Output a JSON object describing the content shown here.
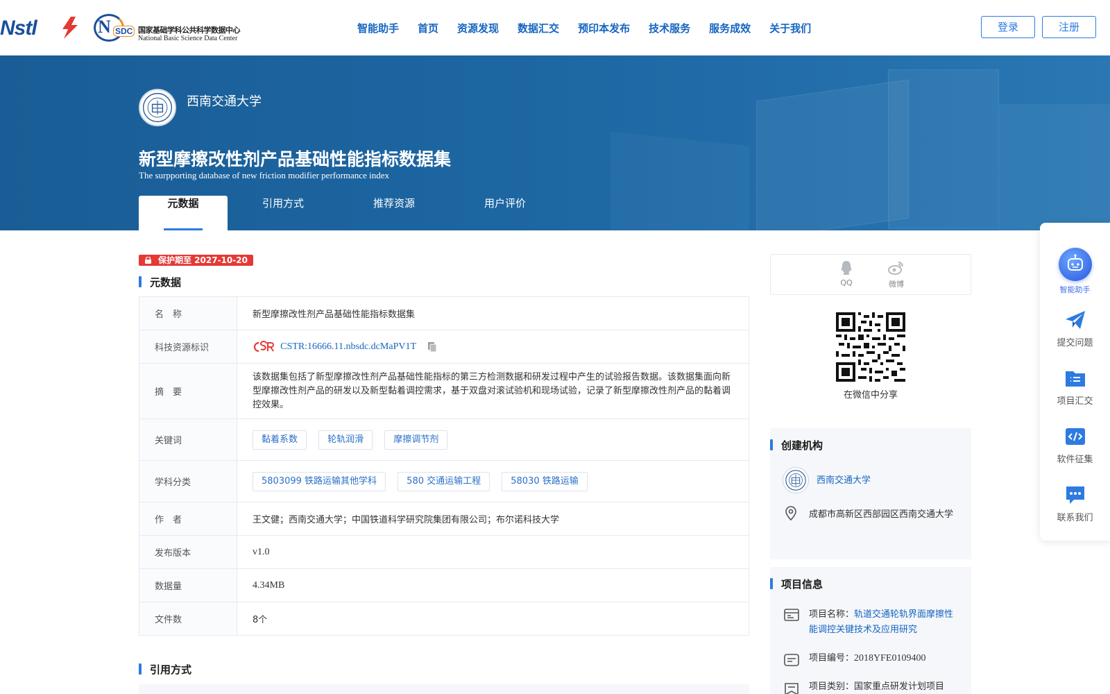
{
  "header": {
    "logo_nstl_text": "Nstl",
    "logo_nsdc_mark": "SDC",
    "logo_nsdc_cn": "国家基础学科公共科学数据中心",
    "logo_nsdc_en": "National Basic Science Data Center",
    "nav": [
      "智能助手",
      "首页",
      "资源发现",
      "数据汇交",
      "预印本发布",
      "技术服务",
      "服务成效",
      "关于我们"
    ],
    "login": "登录",
    "register": "注册"
  },
  "banner": {
    "org_name": "西南交通大学",
    "title": "新型摩擦改性剂产品基础性能指标数据集",
    "subtitle": "The surpporting database of new friction modifier performance index",
    "tabs": [
      "元数据",
      "引用方式",
      "推荐资源",
      "用户评价"
    ],
    "active_tab": "元数据"
  },
  "protection": "保护期至 2027-10-20",
  "metadata": {
    "heading": "元数据",
    "rows": {
      "name": {
        "label": "名　称",
        "value": "新型摩擦改性剂产品基础性能指标数据集"
      },
      "cstr": {
        "label": "科技资源标识",
        "value": "CSTR:16666.11.nbsdc.dcMaPV1T"
      },
      "abstract": {
        "label": "摘　要",
        "value": "该数据集包括了新型摩擦改性剂产品基础性能指标的第三方检测数据和研发过程中产生的试验报告数据。该数据集面向新型摩擦改性剂产品的研发以及新型黏着调控需求，基于双盘对滚试验机和现场试验，记录了新型摩擦改性剂产品的黏着调控效果。"
      },
      "keywords": {
        "label": "关键词",
        "values": [
          "黏着系数",
          "轮轨润滑",
          "摩擦调节剂"
        ]
      },
      "subjects": {
        "label": "学科分类",
        "values": [
          "5803099 铁路运输其他学科",
          "580 交通运输工程",
          "58030 铁路运输"
        ]
      },
      "authors": {
        "label": "作　者",
        "value": "王文健；西南交通大学；中国铁道科学研究院集团有限公司；布尔诺科技大学"
      },
      "version": {
        "label": "发布版本",
        "value": "v1.0"
      },
      "size": {
        "label": "数据量",
        "value": "4.34MB"
      },
      "files": {
        "label": "文件数",
        "value": "8个"
      }
    }
  },
  "citation_heading": "引用方式",
  "share": {
    "qq": "QQ",
    "weibo": "微博",
    "wechat_label": "在微信中分享"
  },
  "creator": {
    "heading": "创建机构",
    "name": "西南交通大学",
    "address": "成都市高新区西部园区西南交通大学"
  },
  "project": {
    "heading": "项目信息",
    "name_label": "项目名称：",
    "name_value": "轨道交通轮轨界面摩擦性能调控关键技术及应用研究",
    "code_label": "项目编号：",
    "code_value": "2018YFE0109400",
    "type_label": "项目类别：",
    "type_value": "国家重点研发计划项目"
  },
  "dock": {
    "ai": "智能助手",
    "submit": "提交问题",
    "project": "项目汇交",
    "software": "软件征集",
    "contact": "联系我们"
  },
  "colors": {
    "primary": "#2d7be0",
    "link": "#1565c0",
    "banner": "#1d67a3",
    "protect": "#e53935"
  }
}
